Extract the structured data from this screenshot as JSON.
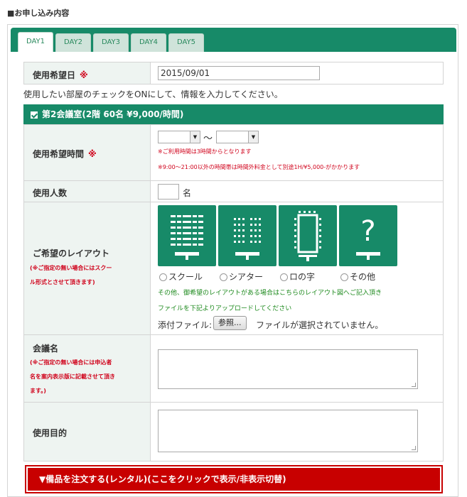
{
  "section_title": "■お申し込み内容",
  "tabs": [
    {
      "label": "DAY1"
    },
    {
      "label": "DAY2"
    },
    {
      "label": "DAY3"
    },
    {
      "label": "DAY4"
    },
    {
      "label": "DAY5"
    }
  ],
  "date_row": {
    "label": "使用希望日",
    "required_mark": "※",
    "value": "2015/09/01"
  },
  "instruction": "使用したい部屋のチェックをONにして、情報を入力してください。",
  "room": {
    "label": "第2会議室(2階 60名 ¥9,000/時間)",
    "checked": true
  },
  "time_row": {
    "label": "使用希望時間",
    "required_mark": "※",
    "separator": "～",
    "note1": "※ご利用時間は3時間からとなります",
    "note2": "※9:00〜21:00以外の時間帯は時間外料金として別途1H/¥5,000-がかかります"
  },
  "people_row": {
    "label": "使用人数",
    "unit": "名",
    "value": ""
  },
  "layout_row": {
    "label": "ご希望のレイアウト",
    "note1": "(※ご指定の無い場合にはスクー",
    "note2": "ル形式とさせて頂きます)",
    "options": [
      "スクール",
      "シアター",
      "ロの字",
      "その他"
    ],
    "other_symbol": "?",
    "note_line1": "その他、御希望のレイアウトがある場合はこちらのレイアウト図へご記入頂き",
    "note_line2": "ファイルを下記よりアップロードしてください",
    "file_label": "添付ファイル:",
    "file_button": "参照...",
    "file_status": "ファイルが選択されていません。"
  },
  "meeting_row": {
    "label": "会議名",
    "note1": "(※ご指定の無い場合には申込者",
    "note2": "名を案内表示版に記載させて頂き",
    "note3": "ます。)"
  },
  "purpose_row": {
    "label": "使用目的"
  },
  "equipment_toggle": "▼備品を注文する(レンタル)(ここをクリックで表示/非表示切替)",
  "colors": {
    "brand_green": "#178a68",
    "alert_red": "#d0021b",
    "toggle_red": "#c80000",
    "note_green": "#1e8a1e"
  }
}
